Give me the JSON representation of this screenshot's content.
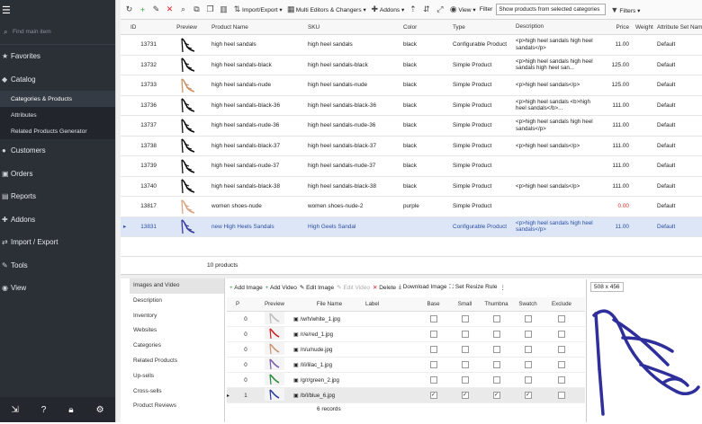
{
  "sidebar": {
    "search_placeholder": "Find main item",
    "items": [
      {
        "label": "Favorites",
        "icon": "star-icon"
      },
      {
        "label": "Catalog",
        "icon": "tag-icon"
      }
    ],
    "catalog_sub": [
      "Categories & Products",
      "Attributes",
      "Related Products Generator"
    ],
    "items2": [
      {
        "label": "Customers",
        "icon": "user-icon"
      },
      {
        "label": "Orders",
        "icon": "cart-icon"
      },
      {
        "label": "Reports",
        "icon": "chart-icon"
      },
      {
        "label": "Addons",
        "icon": "puzzle-icon"
      },
      {
        "label": "Import / Export",
        "icon": "transfer-icon"
      },
      {
        "label": "Tools",
        "icon": "wrench-icon"
      },
      {
        "label": "View",
        "icon": "eye-icon"
      }
    ]
  },
  "toolbar": {
    "import_export": "Import/Export",
    "multi_editors": "Multi Editors & Changers",
    "addons": "Addons",
    "view": "View",
    "filter_label": "Filter",
    "filter_value": "Show products from selected categories",
    "filters": "Filters"
  },
  "grid": {
    "headers": {
      "id": "ID",
      "preview": "Preview",
      "name": "Product Name",
      "sku": "SKU",
      "color": "Color",
      "type": "Type",
      "desc": "Description",
      "price": "Price",
      "weight": "Weight",
      "attr": "Attribute Set Name"
    },
    "rows": [
      {
        "id": "13731",
        "name": "high heel sandals",
        "sku": "high heel sandals",
        "color": "black",
        "type": "Configurable Product",
        "desc": "<p>high heel sandals high heel sandals</p>",
        "price": "11.00",
        "attr": "Default",
        "shoe": "#111111"
      },
      {
        "id": "13732",
        "name": "high heel sandals-black",
        "sku": "high heel sandals-black",
        "color": "black",
        "type": "Simple Product",
        "desc": "<p>high heel sandals high heel sandals high heel san...",
        "price": "125.00",
        "attr": "Default",
        "shoe": "#111111"
      },
      {
        "id": "13733",
        "name": "high heel sandals-nude",
        "sku": "high heel sandals-nude",
        "color": "black",
        "type": "Simple Product",
        "desc": "<p>high heel sandals</p>",
        "price": "125.00",
        "attr": "Default",
        "shoe": "#c9946b"
      },
      {
        "id": "13736",
        "name": "high heel sandals-black-36",
        "sku": "high heel sandals-black-36",
        "color": "black",
        "type": "Simple Product",
        "desc": "<p>high heel sandals <b>high heel sandals</b>...",
        "price": "111.00",
        "attr": "Default",
        "shoe": "#111111"
      },
      {
        "id": "13737",
        "name": "high heel sandals-nude-36",
        "sku": "high heel sandals-nude-36",
        "color": "black",
        "type": "Simple Product",
        "desc": "<p>high heel sandals high heel sandals</p>",
        "price": "111.00",
        "attr": "Default",
        "shoe": "#111111"
      },
      {
        "id": "13738",
        "name": "high heel sandals-black-37",
        "sku": "high heel sandals-black-37",
        "color": "black",
        "type": "Simple Product",
        "desc": "<p>high heel sandals</p>",
        "price": "111.00",
        "attr": "Default",
        "shoe": "#111111"
      },
      {
        "id": "13739",
        "name": "high heel sandals-nude-37",
        "sku": "high heel sandals-nude-37",
        "color": "black",
        "type": "Simple Product",
        "desc": "",
        "price": "111.00",
        "attr": "Default",
        "shoe": "#111111"
      },
      {
        "id": "13740",
        "name": "high heel sandals-black-38",
        "sku": "high heel sandals-black-38",
        "color": "black",
        "type": "Simple Product",
        "desc": "<p>high heel sandals</p>",
        "price": "111.00",
        "attr": "Default",
        "shoe": "#111111"
      },
      {
        "id": "13817",
        "name": "women shoes-nude",
        "sku": "women shoes-nude-2",
        "color": "purple",
        "type": "Simple Product",
        "desc": "",
        "price": "0.00",
        "attr": "Default",
        "shoe": "#d8a584"
      },
      {
        "id": "13831",
        "name": "new High Heels Sandals",
        "sku": "High Geels Sandal",
        "color": "",
        "type": "Configurable Product",
        "desc": "<p>high heel sandals high heel sandals</p>",
        "price": "11.00",
        "attr": "Default",
        "shoe": "#3b3da0"
      }
    ],
    "count": "10 products"
  },
  "tabs": [
    "Images and Video",
    "Description",
    "Inventory",
    "Websites",
    "Categories",
    "Related Products",
    "Up-sells",
    "Cross-sells",
    "Product Reviews"
  ],
  "img_toolbar": {
    "add_image": "Add Image",
    "add_video": "Add Video",
    "edit_image": "Edit Image",
    "edit_video": "Edit Video",
    "delete": "Delete",
    "download": "Download Image",
    "resize": "Set Resize Rule"
  },
  "img_grid": {
    "headers": {
      "pos": "P",
      "preview": "Preview",
      "file": "File Name",
      "label": "Label",
      "base": "Base",
      "small": "Small",
      "thumb": "Thumbna",
      "swatch": "Swatch",
      "exclude": "Exclude"
    },
    "rows": [
      {
        "pos": "0",
        "file": "/w/h/white_1.jpg",
        "color": "#bbbbbb",
        "base": false,
        "small": false,
        "thumb": false,
        "swatch": false
      },
      {
        "pos": "0",
        "file": "/r/e/red_1.jpg",
        "color": "#cc2222",
        "base": false,
        "small": false,
        "thumb": false,
        "swatch": false
      },
      {
        "pos": "0",
        "file": "/n/u/nude.jpg",
        "color": "#c99470",
        "base": false,
        "small": false,
        "thumb": false,
        "swatch": false
      },
      {
        "pos": "0",
        "file": "/l/i/lilac_1.jpg",
        "color": "#7a5aa8",
        "base": false,
        "small": false,
        "thumb": false,
        "swatch": false
      },
      {
        "pos": "0",
        "file": "/g/r/green_2.jpg",
        "color": "#2a8a3a",
        "base": false,
        "small": false,
        "thumb": false,
        "swatch": false
      },
      {
        "pos": "1",
        "file": "/b/l/blue_6.jpg",
        "color": "#2c3aa0",
        "base": true,
        "small": true,
        "thumb": true,
        "swatch": true
      }
    ],
    "count": "6 records"
  },
  "preview": {
    "size": "508 x 456",
    "shoe_color": "#2e2f9a"
  }
}
